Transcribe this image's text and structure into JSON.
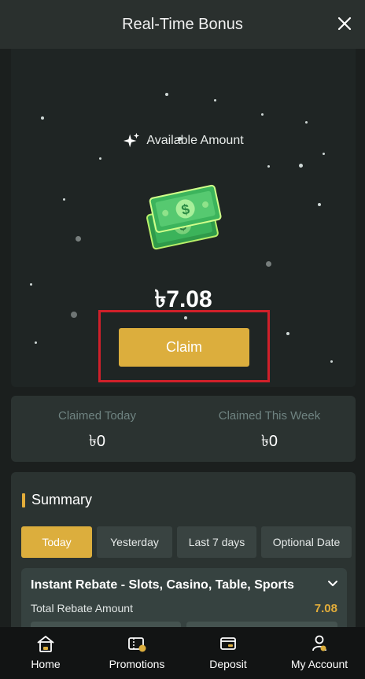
{
  "header": {
    "title": "Real-Time Bonus"
  },
  "hero": {
    "available_label": "Available Amount",
    "amount": "৳7.08",
    "claim_label": "Claim"
  },
  "claimed": [
    {
      "label": "Claimed Today",
      "value": "৳0"
    },
    {
      "label": "Claimed This Week",
      "value": "৳0"
    }
  ],
  "summary": {
    "title": "Summary",
    "tabs": [
      "Today",
      "Yesterday",
      "Last 7 days",
      "Optional Date"
    ],
    "active_tab": "Today",
    "rebate": {
      "title": "Instant Rebate - Slots, Casino, Table, Sports",
      "total_label": "Total Rebate Amount",
      "total_value": "7.08"
    }
  },
  "nav": [
    {
      "label": "Home",
      "icon": "home-icon"
    },
    {
      "label": "Promotions",
      "icon": "promotions-icon"
    },
    {
      "label": "Deposit",
      "icon": "deposit-icon"
    },
    {
      "label": "My Account",
      "icon": "account-icon"
    }
  ],
  "colors": {
    "accent": "#dcae3d",
    "highlight_frame": "#d0202a",
    "panel": "#2b3331",
    "background": "#1b1f1e"
  }
}
